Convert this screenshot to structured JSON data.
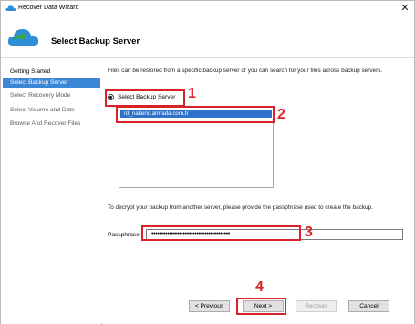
{
  "window": {
    "title": "Recover Data Wizard",
    "close_glyph": "✕"
  },
  "header": {
    "title": "Select Backup Server"
  },
  "nav": {
    "items": [
      {
        "label": "Getting Started"
      },
      {
        "label": "Select Backup Server"
      },
      {
        "label": "Select Recovery Mode"
      },
      {
        "label": "Select Volume and Date"
      },
      {
        "label": "Browse And Recover Files"
      }
    ]
  },
  "main": {
    "intro": "Files can be restored from a specific backup server or you can search for your files across backup servers.",
    "radio_label": "Select Backup Server",
    "servers": [
      "rd_nakenc.armada.com.tr"
    ],
    "passphrase_desc": "To decrypt your backup from another server, please provide the passphrase used to create the backup.",
    "passphrase_label": "Passphrase:",
    "passphrase_value": "••••••••••••••••••••••••••••••••••••••••"
  },
  "buttons": {
    "previous": "< Previous",
    "next": "Next >",
    "recover": "Recover",
    "cancel": "Cancel"
  },
  "annotations": [
    "1",
    "2",
    "3",
    "4"
  ],
  "colors": {
    "selection": "#3c86d6",
    "annotation": "#d8232a",
    "cloud": "#2f8fd6",
    "arrow": "#3aa83a"
  }
}
